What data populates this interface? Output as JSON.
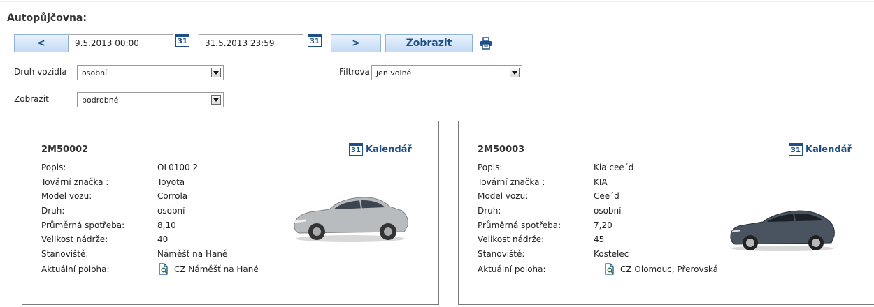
{
  "page": {
    "title": "Autopůjčovna:"
  },
  "toolbar": {
    "prev_label": "<",
    "next_label": ">",
    "show_label": "Zobrazit",
    "date_from": "9.5.2013 00:00",
    "date_to": "31.5.2013 23:59",
    "calendar_icon_text": "31",
    "print_icon": "printer-icon"
  },
  "filters": {
    "druh_label": "Druh vozidla",
    "druh_value": "osobní",
    "filtrovat_label": "Filtrovat",
    "filtrovat_value": "jen volné",
    "zobrazit_label": "Zobrazit",
    "zobrazit_value": "podrobné"
  },
  "field_labels": {
    "popis": "Popis:",
    "znacka": "Tovární značka :",
    "model": "Model vozu:",
    "druh": "Druh:",
    "spotreba": "Průměrná spotřeba:",
    "nadrz": "Velikost nádrže:",
    "stanoviste": "Stanoviště:",
    "poloha": "Aktuální poloha:"
  },
  "cars": [
    {
      "code": "2M50002",
      "calendar_label": "Kalendář",
      "popis": "OL0100 2",
      "znacka": "Toyota",
      "model": "Corrola",
      "druh": "osobní",
      "spotreba": "8,10",
      "nadrz": "40",
      "stanoviste": "Náměšť na Hané",
      "poloha": "CZ Náměšť na Hané",
      "car_color": "#b9bcbf"
    },
    {
      "code": "2M50003",
      "calendar_label": "Kalendář",
      "popis": "Kia cee´d",
      "znacka": "KIA",
      "model": "Cee´d",
      "druh": "osobní",
      "spotreba": "7,20",
      "nadrz": "45",
      "stanoviste": "Kostelec",
      "poloha": "CZ Olomouc, Přerovská",
      "car_color": "#4a5360"
    }
  ],
  "colors": {
    "accent": "#1e4f86",
    "button_bg": "#c3dbf4"
  }
}
